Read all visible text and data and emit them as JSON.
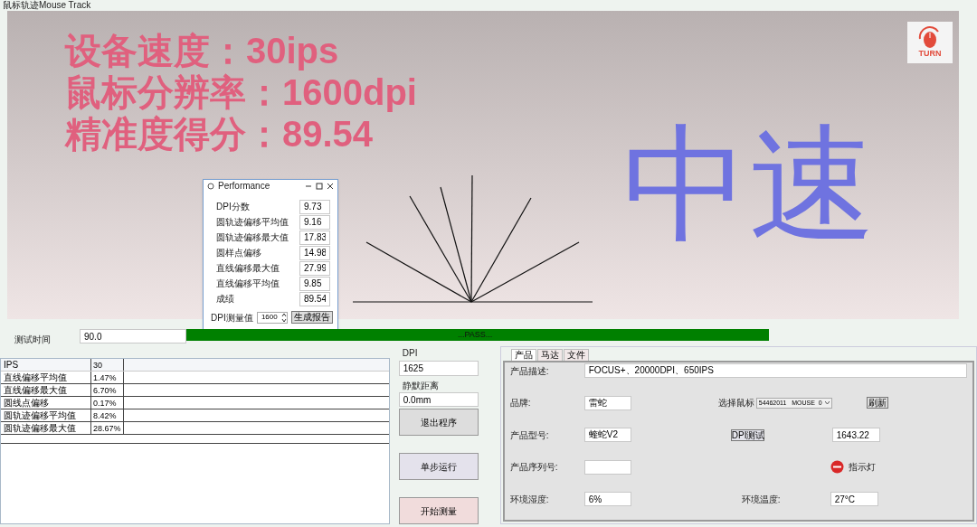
{
  "window": {
    "title": "鼠标轨迹Mouse Track"
  },
  "canvas": {
    "stats": [
      "设备速度：30ips",
      "鼠标分辨率：1600dpi",
      "精准度得分：89.54"
    ],
    "speed_label": "中速",
    "logo_text": "TURN"
  },
  "performance_dialog": {
    "title": "Performance",
    "metrics": [
      {
        "label": "DPI分数",
        "value": "9.73"
      },
      {
        "label": "圆轨迹偏移平均值",
        "value": "9.16"
      },
      {
        "label": "圆轨迹偏移最大值",
        "value": "17.83"
      },
      {
        "label": "圆样点偏移",
        "value": "14.98"
      },
      {
        "label": "直线偏移最大值",
        "value": "27.99"
      },
      {
        "label": "直线偏移平均值",
        "value": "9.85"
      },
      {
        "label": "成绩",
        "value": "89.54"
      }
    ],
    "dpi_measure": {
      "label": "DPI测量值",
      "value": "1600"
    },
    "button": "生成报告"
  },
  "test_time": {
    "label": "测试时间",
    "value": "90.0"
  },
  "progress": {
    "level": 1,
    "text": "...PASS..."
  },
  "results_table": {
    "rows": [
      {
        "name": "IPS",
        "value": "30"
      },
      {
        "name": "直线偏移平均值",
        "value": "1.47%"
      },
      {
        "name": "直线偏移最大值",
        "value": "6.70%"
      },
      {
        "name": "圆线点偏移",
        "value": "0.17%"
      },
      {
        "name": "圆轨迹偏移平均值",
        "value": "8.42%"
      },
      {
        "name": "圆轨迹偏移最大值",
        "value": "28.67%"
      }
    ]
  },
  "dpi": {
    "label": "DPI",
    "value": "1625"
  },
  "silent_distance": {
    "label": "静默距离",
    "value": "0.0mm"
  },
  "buttons": [
    {
      "label": "退出程序",
      "color": "#dddddd"
    },
    {
      "label": "单步运行",
      "color": "#e4e2ec"
    },
    {
      "label": "开始测量",
      "color": "#f1dcdc"
    }
  ],
  "product_panel": {
    "tabs": [
      {
        "label": "产品",
        "selected": true
      },
      {
        "label": "马达",
        "selected": false
      },
      {
        "label": "文件",
        "selected": false
      }
    ],
    "description": {
      "label": "产品描述:",
      "value": "FOCUS+、20000DPI、650IPS"
    },
    "brand": {
      "label": "品牌:",
      "value": "雷蛇"
    },
    "select_mouse": {
      "label": "选择鼠标",
      "value": "54462011   MOUSE  0"
    },
    "refresh_button": "刷新",
    "model": {
      "label": "产品型号:",
      "value": "蝰蛇V2"
    },
    "dpi_test_button": "DPI测试",
    "dpi_test_value": "1643.22",
    "serial": {
      "label": "产品序列号:"
    },
    "indicator": {
      "label": "指示灯"
    },
    "humidity": {
      "label": "环境湿度:",
      "value": "6%"
    },
    "temperature": {
      "label": "环境温度:",
      "value": "27°C"
    }
  }
}
